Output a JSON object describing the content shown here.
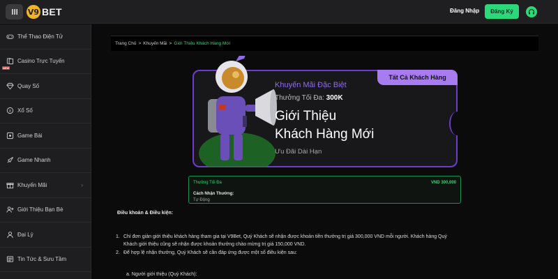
{
  "header": {
    "brand_mark": "V9",
    "brand_text": "BET",
    "login_label": "Đăng Nhập",
    "register_label": "Đăng Ký",
    "icons": [
      "menu-icon",
      "headset-icon"
    ],
    "colors": {
      "accent": "#2bd97a",
      "brand": "#f0b429"
    }
  },
  "sidebar": {
    "items": [
      {
        "label": "Thể Thao Điện Tử",
        "icon": "gamepad-icon"
      },
      {
        "label": "Casino Trực Tuyến",
        "icon": "cards-icon",
        "badge": "NEW"
      },
      {
        "label": "Quay Số",
        "icon": "diamond-icon"
      },
      {
        "label": "Xổ Số",
        "icon": "lottery-ball-icon"
      },
      {
        "label": "Game Bài",
        "icon": "card-game-icon"
      },
      {
        "label": "Game Nhanh",
        "icon": "rocket-icon"
      },
      {
        "label": "Khuyến Mãi",
        "icon": "gift-icon",
        "has_arrow": true
      },
      {
        "label": "Giới Thiệu Bạn Bè",
        "icon": "add-user-icon"
      },
      {
        "label": "Đại Lý",
        "icon": "agent-icon"
      },
      {
        "label": "Tin Tức & Sưu Tầm",
        "icon": "news-icon"
      }
    ],
    "arrow": "›"
  },
  "breadcrumb": {
    "home": "Trang Chủ",
    "section": "Khuyến Mãi",
    "current": "Giới Thiệu Khách Hàng Mới",
    "separator": ">"
  },
  "banner": {
    "tag": "Tất Cả Khách Hàng",
    "subtitle": "Khuyến Mãi Đặc Biệt",
    "max_label": "Thưởng Tối Đa:",
    "max_value": "300K",
    "title_line1": "Giới Thiệu",
    "title_line2": "Khách Hàng Mới",
    "note": "Ưu Đãi Dài Hạn",
    "colors": {
      "border": "#6d3bd6",
      "tag": "#a87cf0",
      "subtitle": "#8e6ee6"
    }
  },
  "info": {
    "max_label": "Thưởng Tối Đa",
    "max_value": "VND 300,000",
    "method_label": "Cách Nhận Thưởng:",
    "method_value": "Tự Động"
  },
  "terms": {
    "title": "Điều khoản & Điều kiện:",
    "item1_num": "1.",
    "item1_line1": "Chỉ đơn giản giới thiệu khách hàng tham gia tại V9Bet, Quý Khách sẽ nhận được khoản tiền thưởng trị giá 300,000 VND mỗi người. Khách hàng Quý",
    "item1_line2": "Khách giới thiệu cũng sẽ nhận được khoản thưởng chào mừng trị giá 150,000 VND.",
    "item2_num": "2.",
    "item2_text": "Để hợp lệ nhận thưởng, Quý Khách sẽ cần đáp ứng được một số điều kiện sau:",
    "sub_a": "a.   Người giới thiệu (Quý Khách):"
  }
}
